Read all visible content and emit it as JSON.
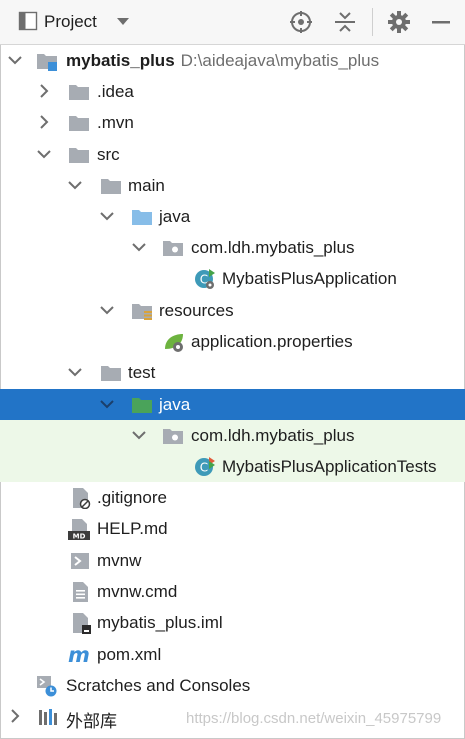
{
  "header": {
    "title": "Project"
  },
  "tree": {
    "root": {
      "name": "mybatis_plus",
      "path": "D:\\aideajava\\mybatis_plus"
    },
    "idea": ".idea",
    "mvn": ".mvn",
    "src": "src",
    "main": "main",
    "main_java": "java",
    "main_package": "com.ldh.mybatis_plus",
    "main_app": "MybatisPlusApplication",
    "resources": "resources",
    "app_props": "application.properties",
    "test": "test",
    "test_java": "java",
    "test_package": "com.ldh.mybatis_plus",
    "test_class": "MybatisPlusApplicationTests",
    "gitignore": ".gitignore",
    "help": "HELP.md",
    "mvnw": "mvnw",
    "mvnw_cmd": "mvnw.cmd",
    "iml": "mybatis_plus.iml",
    "pom": "pom.xml",
    "scratches": "Scratches and Consoles",
    "external_libs": "外部库"
  },
  "watermark": "https://blog.csdn.net/weixin_45975799",
  "colors": {
    "selection": "#2274c7",
    "hover_row": "#edf8e8",
    "folder": "#a7acb3",
    "source_folder": "#87bde8",
    "test_folder": "#4aa35a"
  }
}
